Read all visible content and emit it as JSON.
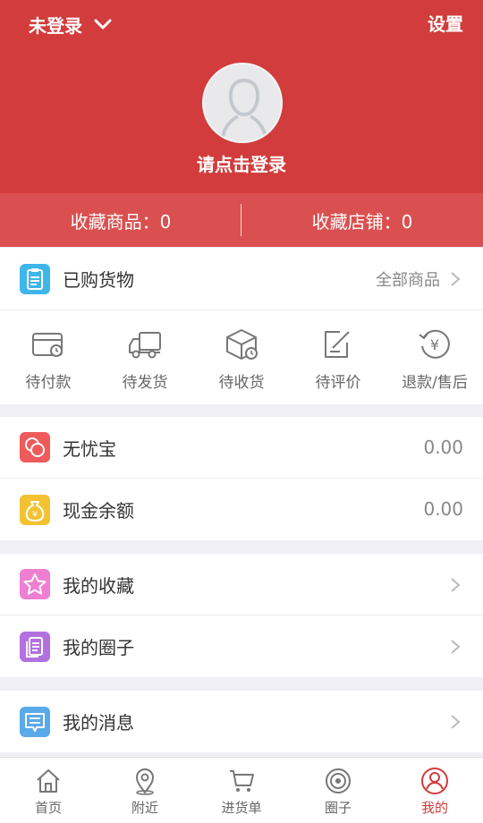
{
  "header": {
    "login_status": "未登录",
    "settings_label": "设置",
    "login_prompt": "请点击登录",
    "background_color": "#d23c3c"
  },
  "stats": {
    "favorite_goods": "收藏商品：0",
    "favorite_shops": "收藏店铺：0"
  },
  "orders": {
    "title": "已购货物",
    "all_label": "全部商品",
    "items": [
      {
        "label": "待付款",
        "icon": "wallet-clock-icon"
      },
      {
        "label": "待发货",
        "icon": "truck-icon"
      },
      {
        "label": "待收货",
        "icon": "package-icon"
      },
      {
        "label": "待评价",
        "icon": "edit-note-icon"
      },
      {
        "label": "退款/售后",
        "icon": "refund-icon"
      }
    ]
  },
  "wallet": {
    "baoxian_label": "无忧宝",
    "baoxian_value": "0.00",
    "cash_label": "现金余额",
    "cash_value": "0.00"
  },
  "menu": {
    "favorites_label": "我的收藏",
    "circle_label": "我的圈子",
    "messages_label": "我的消息"
  },
  "tabbar": {
    "items": [
      {
        "label": "首页",
        "icon": "home-icon"
      },
      {
        "label": "附近",
        "icon": "location-pin-icon"
      },
      {
        "label": "进货单",
        "icon": "cart-icon"
      },
      {
        "label": "圈子",
        "icon": "target-icon"
      },
      {
        "label": "我的",
        "icon": "user-icon",
        "active": true
      }
    ],
    "active_color": "#d23c3c"
  }
}
